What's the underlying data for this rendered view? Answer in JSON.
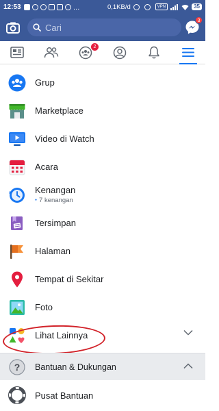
{
  "status_bar": {
    "time": "12:53",
    "network_speed": "0,1KB/d",
    "vpn_label": "VPN",
    "signal_text": "4G",
    "battery": "35"
  },
  "top_bar": {
    "search_placeholder": "Cari",
    "messenger_badge": "3",
    "bg_color": "#3b5998"
  },
  "tabs": [
    {
      "name": "news-feed-icon",
      "active": false
    },
    {
      "name": "friends-icon",
      "active": false
    },
    {
      "name": "groups-icon",
      "active": false,
      "badge": "2"
    },
    {
      "name": "profile-icon",
      "active": false
    },
    {
      "name": "notifications-icon",
      "active": false
    },
    {
      "name": "menu-icon",
      "active": true
    }
  ],
  "menu": {
    "items": [
      {
        "label": "Grup"
      },
      {
        "label": "Marketplace"
      },
      {
        "label": "Video di Watch"
      },
      {
        "label": "Acara"
      },
      {
        "label": "Kenangan",
        "sub": "7 kenangan"
      },
      {
        "label": "Tersimpan"
      },
      {
        "label": "Halaman"
      },
      {
        "label": "Tempat di Sekitar"
      },
      {
        "label": "Foto"
      }
    ],
    "see_more": "Lihat Lainnya"
  },
  "help": {
    "section_title": "Bantuan & Dukungan",
    "help_center": "Pusat Bantuan"
  },
  "colors": {
    "accent": "#1877f2",
    "highlight_circle": "#d2232a"
  }
}
